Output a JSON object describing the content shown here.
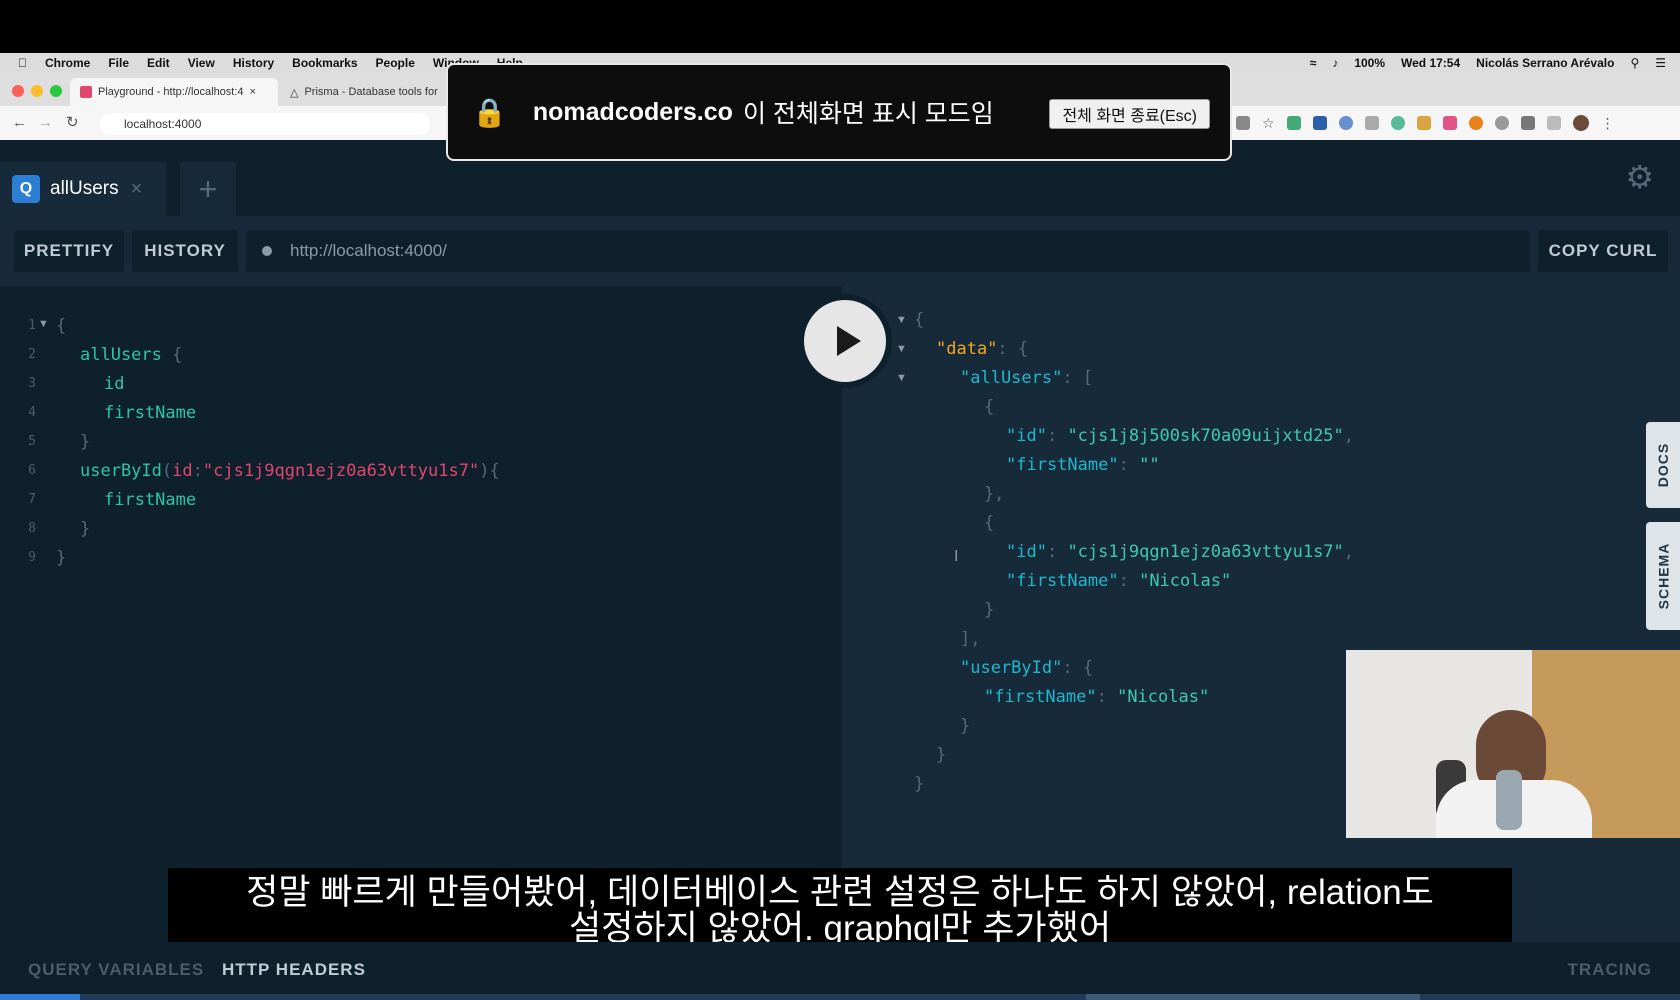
{
  "menubar": {
    "apple": "",
    "items": [
      "Chrome",
      "File",
      "Edit",
      "View",
      "History",
      "Bookmarks",
      "People",
      "Window",
      "Help"
    ],
    "battery": "100%",
    "datetime": "Wed 17:54",
    "user": "Nicolás Serrano Arévalo"
  },
  "browser": {
    "tabs": [
      {
        "label": "Playground - http://localhost:4",
        "close": "×"
      },
      {
        "label": "Prisma - Database tools for"
      }
    ],
    "address": "localhost:4000"
  },
  "fullscreen_notice": {
    "domain": "nomadcoders.co",
    "message": "이 전체화면 표시 모드임",
    "exit_button": "전체 화면 종료(Esc)"
  },
  "playground": {
    "tab_label": "allUsers",
    "tab_badge": "Q",
    "tab_close": "×",
    "new_tab": "+",
    "prettify": "PRETTIFY",
    "history": "HISTORY",
    "endpoint": "http://localhost:4000/",
    "copy_curl": "COPY CURL",
    "docs_tab": "DOCS",
    "schema_tab": "SCHEMA",
    "query_variables": "QUERY VARIABLES",
    "http_headers": "HTTP HEADERS",
    "tracing": "TRACING"
  },
  "editor": {
    "line_numbers": [
      "1",
      "2",
      "3",
      "4",
      "5",
      "6",
      "7",
      "8",
      "9"
    ],
    "lines": {
      "l1": "{",
      "l2": "allUsers",
      "l2b": "{",
      "l3": "id",
      "l4": "firstName",
      "l5": "}",
      "l6_field": "userById",
      "l6_open": "(",
      "l6_arg": "id",
      "l6_colon": ":",
      "l6_value": "\"cjs1j9qgn1ejz0a63vttyu1s7\"",
      "l6_close": "){",
      "l7": "firstName",
      "l8": "}",
      "l9": "}"
    }
  },
  "result": {
    "r1": "{",
    "data_key": "\"data\"",
    "colon_brace": ": {",
    "allusers_key": "\"allUsers\"",
    "colon_bracket": ": [",
    "obj_open": "{",
    "id_key": "\"id\"",
    "firstname_key": "\"firstName\"",
    "user1_id": "\"cjs1j8j500sk70a09uijxtd25\"",
    "user1_first": "\"\"",
    "obj_close_comma": "},",
    "user2_id": "\"cjs1j9qgn1ejz0a63vttyu1s7\"",
    "user2_first": "\"Nicolas\"",
    "obj_close": "}",
    "arr_close": "],",
    "userbyid_key": "\"userById\"",
    "userbyid_first": "\"Nicolas\"",
    "close1": "}",
    "close2": "}",
    "close3": "}",
    "sep": ": ",
    "comma": ","
  },
  "subtitle": {
    "line1": "정말 빠르게 만들어봤어, 데이터베이스 관련 설정은 하나도 하지 않았어, relation도",
    "line2": "설정하지 않았어. graphql만 추가했어"
  },
  "colors": {
    "editor_bg": "#0f202d",
    "result_bg": "#172a3a",
    "field": "#2ec4a9",
    "argument": "#e0466e",
    "json_key": "#1eb8ce",
    "data_key": "#f5a623"
  }
}
